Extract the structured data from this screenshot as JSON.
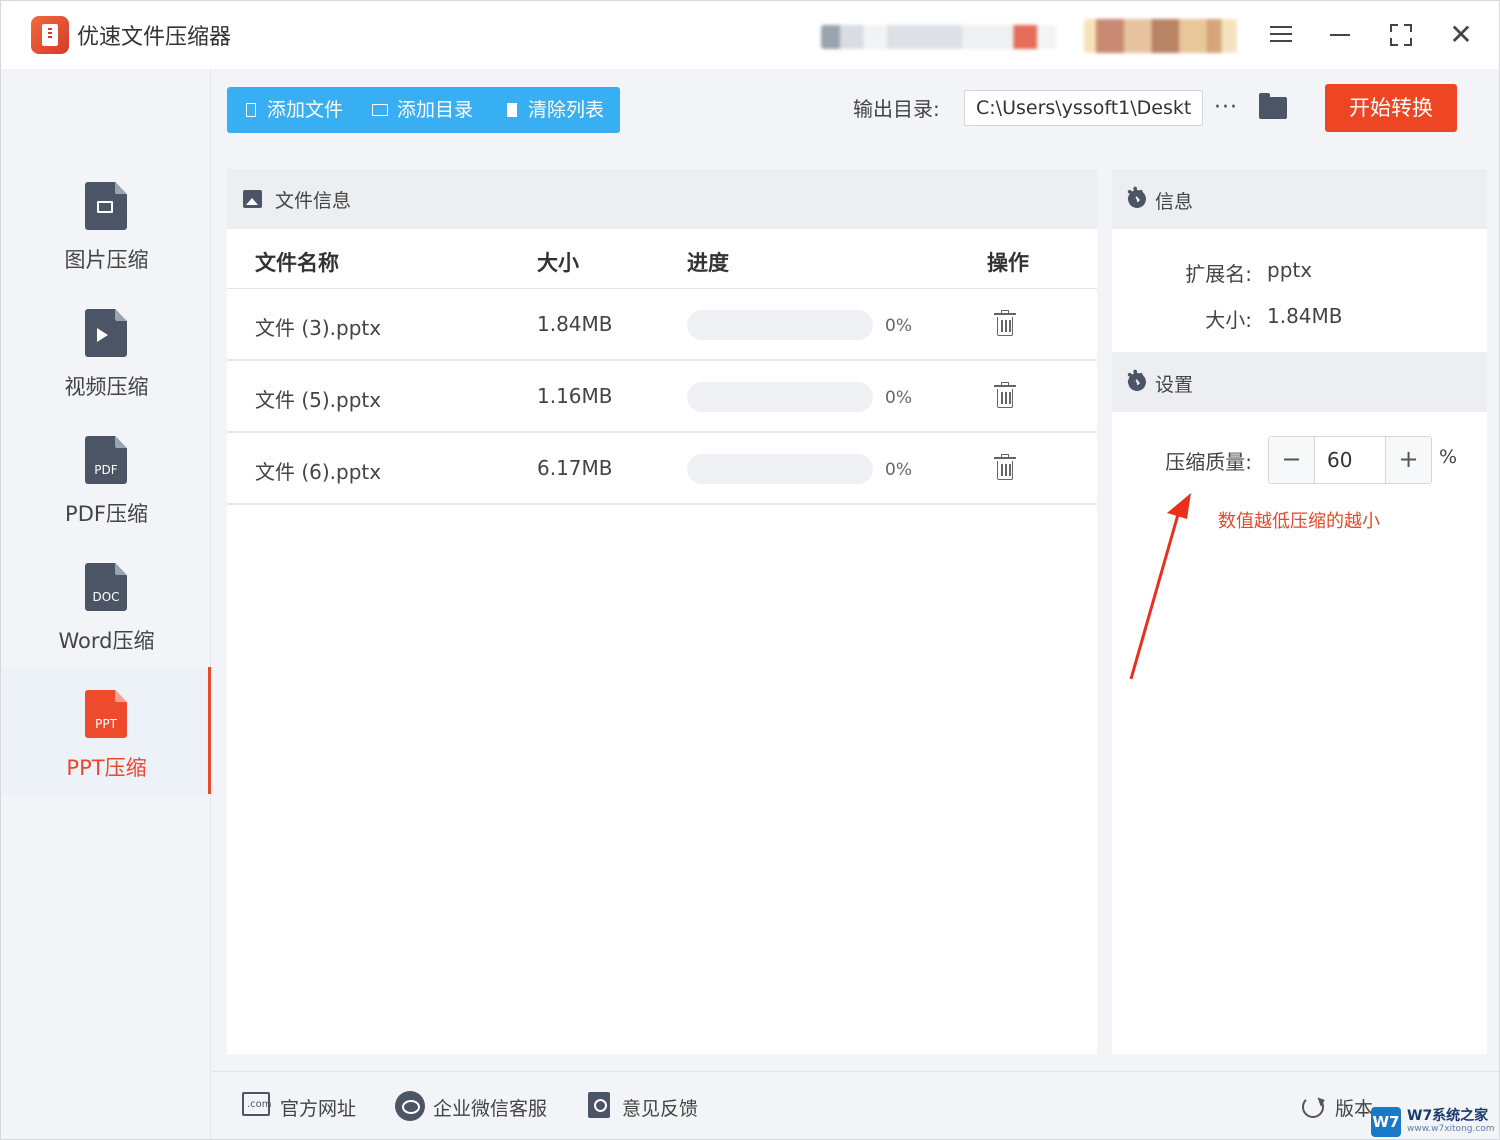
{
  "app": {
    "title": "优速文件压缩器"
  },
  "sidebar": {
    "items": [
      {
        "label": "图片压缩",
        "tag": "",
        "icon": "image-file-icon",
        "active": false
      },
      {
        "label": "视频压缩",
        "tag": "",
        "icon": "video-file-icon",
        "active": false
      },
      {
        "label": "PDF压缩",
        "tag": "PDF",
        "icon": "pdf-file-icon",
        "active": false
      },
      {
        "label": "Word压缩",
        "tag": "DOC",
        "icon": "doc-file-icon",
        "active": false
      },
      {
        "label": "PPT压缩",
        "tag": "PPT",
        "icon": "ppt-file-icon",
        "active": true
      }
    ]
  },
  "toolbar": {
    "add_file": "添加文件",
    "add_dir": "添加目录",
    "clear_list": "清除列表",
    "output_label": "输出目录:",
    "output_path": "C:\\Users\\yssoft1\\Deskto",
    "more": "···",
    "start": "开始转换"
  },
  "file_panel": {
    "title": "文件信息",
    "columns": {
      "name": "文件名称",
      "size": "大小",
      "progress": "进度",
      "action": "操作"
    },
    "rows": [
      {
        "name": "文件 (3).pptx",
        "size": "1.84MB",
        "progress": 0,
        "progress_text": "0%"
      },
      {
        "name": "文件 (5).pptx",
        "size": "1.16MB",
        "progress": 0,
        "progress_text": "0%"
      },
      {
        "name": "文件 (6).pptx",
        "size": "6.17MB",
        "progress": 0,
        "progress_text": "0%"
      }
    ]
  },
  "info_panel": {
    "info_title": "信息",
    "ext_label": "扩展名:",
    "ext_value": "pptx",
    "size_label": "大小:",
    "size_value": "1.84MB",
    "settings_title": "设置",
    "quality_label": "压缩质量:",
    "quality_value": "60",
    "minus": "−",
    "plus": "+",
    "percent": "%",
    "hint": "数值越低压缩的越小"
  },
  "footer": {
    "website": "官方网址",
    "wechat": "企业微信客服",
    "feedback": "意见反馈",
    "version": "版本"
  },
  "watermark": {
    "logo": "W7",
    "text": "W7系统之家",
    "sub": "www.w7xitong.com"
  },
  "colors": {
    "accent_blue": "#38aef3",
    "accent_red": "#ee4624",
    "active_text": "#e9482d"
  }
}
